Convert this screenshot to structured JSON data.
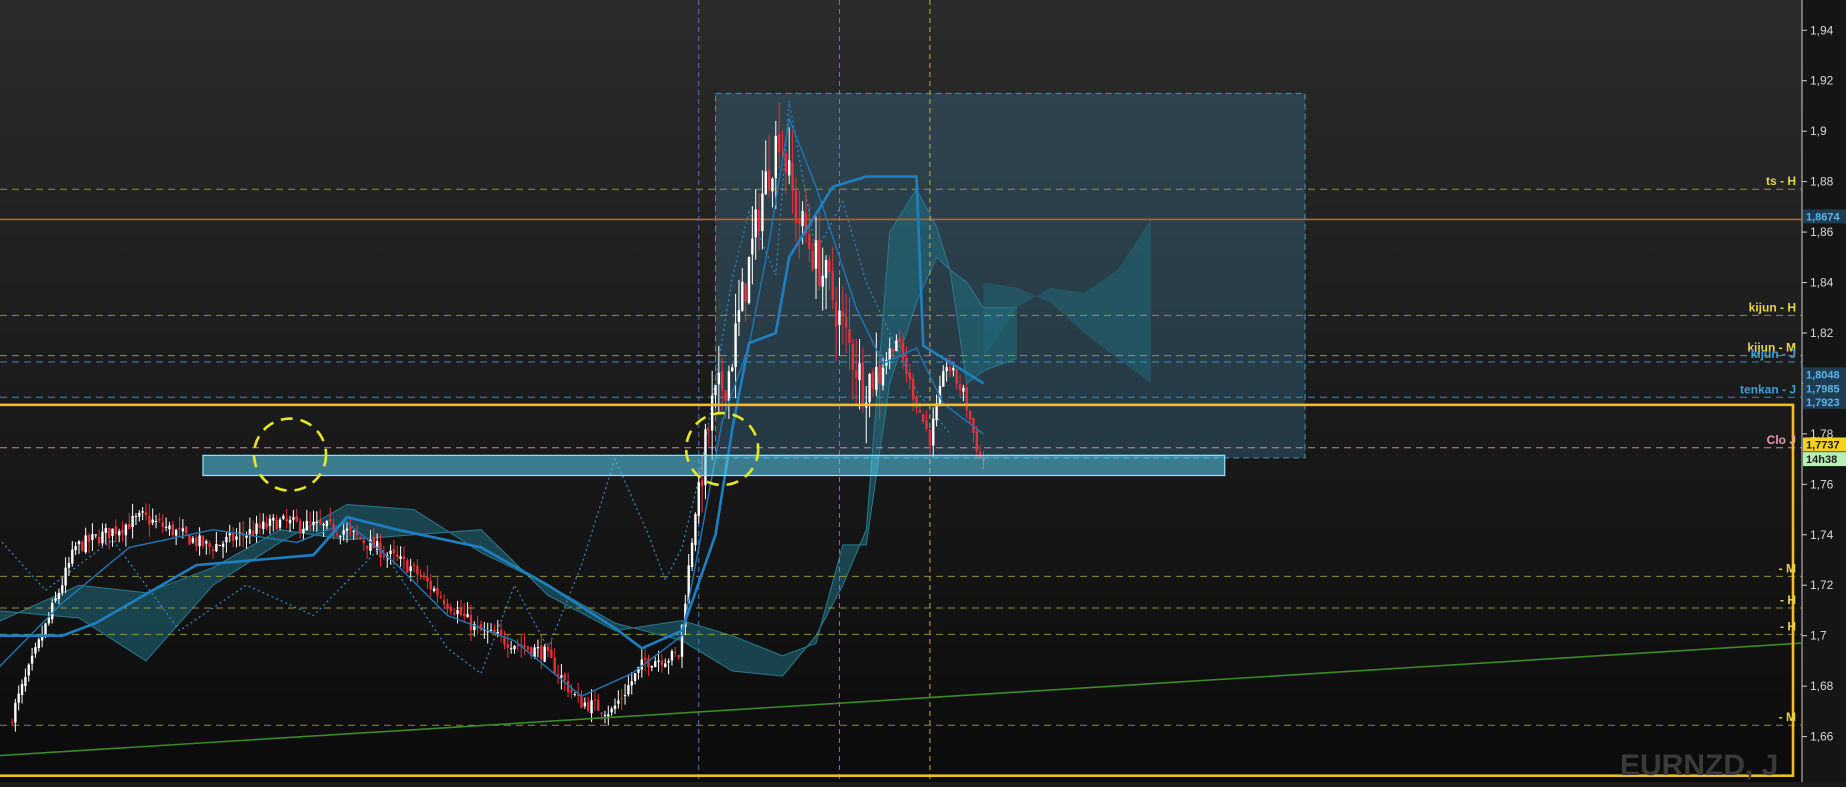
{
  "chart_data": {
    "type": "candlestick",
    "instrument": "EURNZD, J",
    "y_axis": {
      "side": "right",
      "range": [
        1.642,
        1.952
      ],
      "ticks": [
        "1,94",
        "1,92",
        "1,9",
        "1,88",
        "1,86",
        "1,84",
        "1,82",
        "1,8",
        "1,78",
        "1,76",
        "1,74",
        "1,72",
        "1,7",
        "1,68",
        "1,66"
      ],
      "tick_values": [
        1.94,
        1.92,
        1.9,
        1.88,
        1.86,
        1.84,
        1.82,
        1.8,
        1.78,
        1.76,
        1.74,
        1.72,
        1.7,
        1.68,
        1.66
      ]
    },
    "grid": false,
    "colors": {
      "background_top": "#2a2a2a",
      "background_bottom": "#0c0c0c",
      "bull": "#ffffff",
      "bear": "#e8303a",
      "kumo": "#1f6e80",
      "kijun": "#1e80c4",
      "chikou": "#2f8ccc",
      "level_yellow": "#a5a53a",
      "level_orange": "#c0621e",
      "highlight_yellow": "#f0c020",
      "zone_cyan": "#5ad2f2",
      "trendline": "#3a8a2a"
    },
    "horizontal_levels": [
      {
        "label": "ts - H",
        "value": 1.877,
        "color": "#a5a53a"
      },
      {
        "label": "",
        "value": 1.865,
        "color": "#c0621e",
        "solid": true
      },
      {
        "label": "kijun - H",
        "value": 1.827,
        "color": "#a5a53a"
      },
      {
        "label": "kijun - M",
        "value": 1.811,
        "color": "#a5a53a"
      },
      {
        "label": "kijun - J",
        "value": 1.8085,
        "color": "#3aa0d8"
      },
      {
        "label": "tenkan - J",
        "value": 1.7945,
        "color": "#3aa0d8"
      },
      {
        "label": "Clo J",
        "value": 1.7745,
        "color": "#e59ab5"
      },
      {
        "label": "- M",
        "value": 1.7235,
        "color": "#a5a53a"
      },
      {
        "label": "- H",
        "value": 1.711,
        "color": "#a5a53a"
      },
      {
        "label": "- H",
        "value": 1.7005,
        "color": "#a5a53a"
      },
      {
        "label": "- M",
        "value": 1.6645,
        "color": "#a5a53a"
      }
    ],
    "price_tags": [
      {
        "text": "1,8674",
        "value": 1.8662,
        "bg": "#1e3c52",
        "fg": "#5ab4e8"
      },
      {
        "text": "1,8048",
        "value": 1.8036,
        "bg": "#1e3c52",
        "fg": "#5ab4e8"
      },
      {
        "text": "1,7985",
        "value": 1.798,
        "bg": "#1e3c52",
        "fg": "#5ab4e8"
      },
      {
        "text": "1,7923",
        "value": 1.7927,
        "bg": "#1e3c52",
        "fg": "#5ab4e8"
      },
      {
        "text": "1,7737",
        "value": 1.7758,
        "bg": "#f5d21c",
        "fg": "#1a1a1a"
      },
      {
        "text": "14h38",
        "value": 1.77,
        "bg": "#b4f0b4",
        "fg": "#1a1a1a"
      }
    ],
    "vertical_markers": [
      {
        "bar": 205,
        "color": "#3c7ac8"
      },
      {
        "bar": 247,
        "color": "#c84ac0"
      },
      {
        "bar": 274,
        "color": "#d9a628"
      }
    ],
    "zones": [
      {
        "name": "support-band",
        "bar_from": 57,
        "bar_to": 362,
        "y_from": 1.7635,
        "y_to": 1.7715,
        "color": "#5ad2f2"
      },
      {
        "name": "projection-box",
        "bar_from": 210,
        "bar_to": 386,
        "y_from": 1.7705,
        "y_to": 1.915,
        "color": "#3c7896"
      },
      {
        "name": "highlight-rectangle",
        "bar_from": -100,
        "bar_to": 600,
        "y_from": 1.6445,
        "y_to": 1.7915,
        "color": "#f0c020"
      }
    ],
    "circles": [
      {
        "bar": 83,
        "value": 1.7718
      },
      {
        "bar": 212,
        "value": 1.774
      }
    ],
    "trendline": {
      "from_bar": -100,
      "from_value": 1.6445,
      "to_bar": 600,
      "to_value": 1.7025
    },
    "anchors": {
      "bars": [
        0,
        20,
        40,
        60,
        80,
        100,
        120,
        140,
        160,
        170,
        180,
        190,
        200,
        205,
        210,
        215,
        220,
        225,
        230,
        235,
        240,
        245,
        250,
        255,
        260,
        265,
        270,
        275,
        280,
        285,
        290
      ],
      "values": [
        1.665,
        1.735,
        1.747,
        1.735,
        1.745,
        1.742,
        1.727,
        1.702,
        1.693,
        1.674,
        1.67,
        1.69,
        1.692,
        1.75,
        1.79,
        1.805,
        1.84,
        1.875,
        1.9,
        1.868,
        1.852,
        1.838,
        1.818,
        1.8,
        1.805,
        1.818,
        1.796,
        1.778,
        1.808,
        1.796,
        1.77
      ]
    },
    "bar_spacing_px": 3.35,
    "bar_count": 291,
    "indicators": {
      "kijun": {
        "bars": [
          -5,
          15,
          25,
          55,
          90,
          100,
          115,
          140,
          160,
          180,
          188,
          200,
          210,
          215,
          220,
          228,
          232,
          245,
          255,
          270,
          272,
          290
        ],
        "values": [
          1.7,
          1.7,
          1.705,
          1.728,
          1.732,
          1.747,
          1.742,
          1.735,
          1.72,
          1.703,
          1.695,
          1.702,
          1.74,
          1.782,
          1.816,
          1.82,
          1.85,
          1.878,
          1.882,
          1.882,
          1.815,
          1.8
        ]
      },
      "tenkan": {
        "bars": [
          -5,
          15,
          35,
          60,
          85,
          100,
          115,
          130,
          150,
          170,
          185,
          200,
          205,
          212,
          220,
          226,
          232,
          240,
          247,
          252,
          260,
          270,
          278,
          290
        ],
        "values": [
          1.686,
          1.713,
          1.735,
          1.742,
          1.737,
          1.745,
          1.728,
          1.708,
          1.698,
          1.676,
          1.685,
          1.7,
          1.735,
          1.785,
          1.815,
          1.856,
          1.905,
          1.878,
          1.85,
          1.83,
          1.808,
          1.814,
          1.792,
          1.78
        ]
      },
      "senkou_a": {
        "bars": [
          -5,
          20,
          40,
          60,
          80,
          100,
          120,
          140,
          160,
          180,
          200,
          215,
          230,
          240,
          248,
          255,
          262,
          270,
          276,
          280,
          285,
          290,
          300
        ],
        "values": [
          1.705,
          1.72,
          1.717,
          1.727,
          1.742,
          1.738,
          1.74,
          1.742,
          1.716,
          1.702,
          1.706,
          1.7,
          1.692,
          1.697,
          1.736,
          1.736,
          1.8,
          1.832,
          1.85,
          1.845,
          1.8,
          1.805,
          1.81
        ]
      },
      "senkou_b": {
        "bars": [
          -5,
          20,
          40,
          60,
          80,
          100,
          120,
          140,
          160,
          180,
          200,
          215,
          230,
          240,
          248,
          255,
          262,
          270,
          276,
          280,
          285,
          290,
          300
        ],
        "values": [
          1.71,
          1.707,
          1.69,
          1.72,
          1.737,
          1.752,
          1.75,
          1.733,
          1.72,
          1.705,
          1.698,
          1.686,
          1.684,
          1.7,
          1.72,
          1.742,
          1.86,
          1.877,
          1.862,
          1.845,
          1.84,
          1.83,
          1.83
        ]
      },
      "future_a": {
        "bars": [
          290,
          300,
          310,
          320,
          330,
          340
        ],
        "values": [
          1.81,
          1.83,
          1.838,
          1.836,
          1.845,
          1.865
        ]
      },
      "future_b": {
        "bars": [
          290,
          300,
          310,
          320,
          330,
          340
        ],
        "values": [
          1.84,
          1.838,
          1.832,
          1.82,
          1.81,
          1.8
        ]
      },
      "chikou": {
        "bars": [
          -5,
          10,
          30,
          50,
          70,
          90,
          110,
          130,
          140,
          150,
          160,
          170,
          180,
          190,
          195,
          200,
          205,
          208,
          215,
          220,
          228,
          232,
          240,
          248,
          255,
          262,
          270,
          280
        ],
        "values": [
          1.74,
          1.718,
          1.738,
          1.702,
          1.72,
          1.708,
          1.735,
          1.695,
          1.685,
          1.72,
          1.695,
          1.728,
          1.77,
          1.74,
          1.722,
          1.735,
          1.762,
          1.785,
          1.842,
          1.868,
          1.843,
          1.912,
          1.852,
          1.872,
          1.84,
          1.82,
          1.797,
          1.78
        ]
      }
    }
  }
}
